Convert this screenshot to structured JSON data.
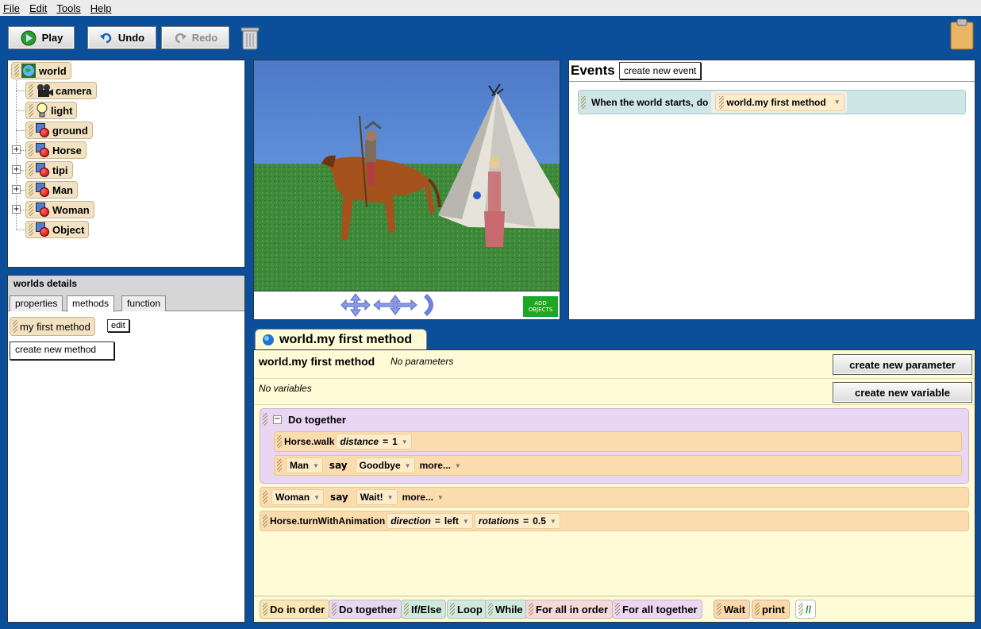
{
  "menu": [
    "File",
    "Edit",
    "Tools",
    "Help"
  ],
  "toolbar": {
    "play": "Play",
    "undo": "Undo",
    "redo": "Redo"
  },
  "tree": {
    "root": "world",
    "children": [
      "camera",
      "light",
      "ground",
      "Horse",
      "tipi",
      "Man",
      "Woman",
      "Object"
    ]
  },
  "details": {
    "title": "worlds details",
    "tabs": [
      "properties",
      "methods",
      "function"
    ],
    "method_name": "my first method",
    "edit": "edit",
    "create_method": "create new method"
  },
  "scene": {
    "add_objects_line1": "ADD",
    "add_objects_line2": "OBJECTS"
  },
  "events": {
    "title": "Events",
    "create_event": "create new event",
    "when_label": "When the world starts,",
    "do_label": "do",
    "method": "world.my first method"
  },
  "editor": {
    "tab_title": "world.my first method",
    "method_name": "world.my first method",
    "no_params": "No parameters",
    "no_vars": "No variables",
    "create_param": "create new parameter",
    "create_var": "create new variable",
    "do_together": "Do together",
    "stmt1": {
      "method": "Horse.walk",
      "param": "distance",
      "eq": "=",
      "value": "1"
    },
    "stmt2": {
      "obj": "Man",
      "verb": "say",
      "value": "Goodbye",
      "more": "more..."
    },
    "stmt3": {
      "obj": "Woman",
      "verb": "say",
      "value": "Wait!",
      "more": "more..."
    },
    "stmt4": {
      "method": "Horse.turnWithAnimation",
      "p1": "direction",
      "eq1": "=",
      "v1": "left",
      "p2": "rotations",
      "eq2": "=",
      "v2": "0.5"
    }
  },
  "bottom_tiles": [
    "Do in order",
    "Do together",
    "If/Else",
    "Loop",
    "While",
    "For all in order",
    "For all together",
    "Wait",
    "print",
    "//"
  ],
  "colors": {
    "background": "#0b4f9a",
    "editor": "#fffbd6",
    "events_row": "#cfe6e6",
    "do_together": "#e9d6f3"
  }
}
